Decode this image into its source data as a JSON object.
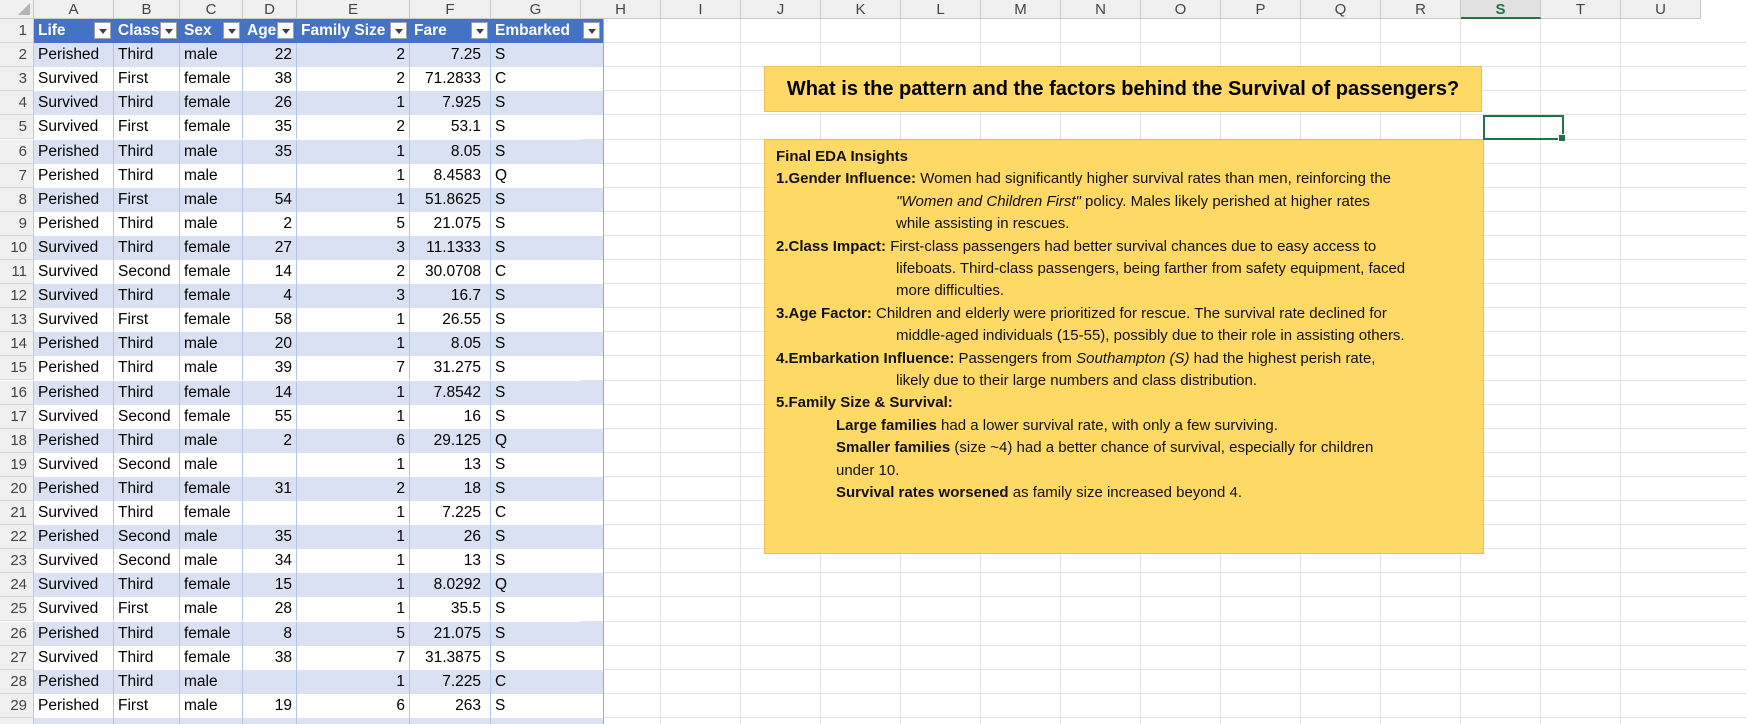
{
  "columns": [
    "A",
    "B",
    "C",
    "D",
    "E",
    "F",
    "G",
    "H",
    "I",
    "J",
    "K",
    "L",
    "M",
    "N",
    "O",
    "P",
    "Q",
    "R",
    "S",
    "T",
    "U"
  ],
  "selected_column": "S",
  "table": {
    "headers": [
      "Life",
      "Class",
      "Sex",
      "Age",
      "Family Size",
      "Fare",
      "Embarked"
    ],
    "rows": [
      [
        "Perished",
        "Third",
        "male",
        "22",
        "2",
        "7.25",
        "S"
      ],
      [
        "Survived",
        "First",
        "female",
        "38",
        "2",
        "71.2833",
        "C"
      ],
      [
        "Survived",
        "Third",
        "female",
        "26",
        "1",
        "7.925",
        "S"
      ],
      [
        "Survived",
        "First",
        "female",
        "35",
        "2",
        "53.1",
        "S"
      ],
      [
        "Perished",
        "Third",
        "male",
        "35",
        "1",
        "8.05",
        "S"
      ],
      [
        "Perished",
        "Third",
        "male",
        "",
        "1",
        "8.4583",
        "Q"
      ],
      [
        "Perished",
        "First",
        "male",
        "54",
        "1",
        "51.8625",
        "S"
      ],
      [
        "Perished",
        "Third",
        "male",
        "2",
        "5",
        "21.075",
        "S"
      ],
      [
        "Survived",
        "Third",
        "female",
        "27",
        "3",
        "11.1333",
        "S"
      ],
      [
        "Survived",
        "Second",
        "female",
        "14",
        "2",
        "30.0708",
        "C"
      ],
      [
        "Survived",
        "Third",
        "female",
        "4",
        "3",
        "16.7",
        "S"
      ],
      [
        "Survived",
        "First",
        "female",
        "58",
        "1",
        "26.55",
        "S"
      ],
      [
        "Perished",
        "Third",
        "male",
        "20",
        "1",
        "8.05",
        "S"
      ],
      [
        "Perished",
        "Third",
        "male",
        "39",
        "7",
        "31.275",
        "S"
      ],
      [
        "Perished",
        "Third",
        "female",
        "14",
        "1",
        "7.8542",
        "S"
      ],
      [
        "Survived",
        "Second",
        "female",
        "55",
        "1",
        "16",
        "S"
      ],
      [
        "Perished",
        "Third",
        "male",
        "2",
        "6",
        "29.125",
        "Q"
      ],
      [
        "Survived",
        "Second",
        "male",
        "",
        "1",
        "13",
        "S"
      ],
      [
        "Perished",
        "Third",
        "female",
        "31",
        "2",
        "18",
        "S"
      ],
      [
        "Survived",
        "Third",
        "female",
        "",
        "1",
        "7.225",
        "C"
      ],
      [
        "Perished",
        "Second",
        "male",
        "35",
        "1",
        "26",
        "S"
      ],
      [
        "Survived",
        "Second",
        "male",
        "34",
        "1",
        "13",
        "S"
      ],
      [
        "Survived",
        "Third",
        "female",
        "15",
        "1",
        "8.0292",
        "Q"
      ],
      [
        "Survived",
        "First",
        "male",
        "28",
        "1",
        "35.5",
        "S"
      ],
      [
        "Perished",
        "Third",
        "female",
        "8",
        "5",
        "21.075",
        "S"
      ],
      [
        "Survived",
        "Third",
        "female",
        "38",
        "7",
        "31.3875",
        "S"
      ],
      [
        "Perished",
        "Third",
        "male",
        "",
        "1",
        "7.225",
        "C"
      ],
      [
        "Perished",
        "First",
        "male",
        "19",
        "6",
        "263",
        "S"
      ]
    ]
  },
  "title_box": {
    "text": "What is the pattern and the factors behind the Survival of passengers?"
  },
  "insights": {
    "heading": "Final EDA Insights",
    "p1_bold": "1.Gender Influence:",
    "p1_a": " Women had significantly higher survival rates than men, reinforcing the",
    "p1_b_italic": "\"Women and Children First\"",
    "p1_b_rest": " policy. Males likely perished at higher rates",
    "p1_c": "while assisting in rescues.",
    "p2_bold": "2.Class Impact:",
    "p2_a": " First-class passengers had better survival chances due to easy access to",
    "p2_b": "lifeboats. Third-class passengers, being farther from safety equipment, faced",
    "p2_c": "more difficulties.",
    "p3_bold": "3.Age Factor:",
    "p3_a": " Children and elderly were prioritized for rescue. The survival rate declined for",
    "p3_b": "middle-aged individuals (15-55), possibly due to their role in assisting others.",
    "p4_bold": "4.Embarkation Influence:",
    "p4_a_pre": " Passengers from ",
    "p4_a_italic": "Southampton (S)",
    "p4_a_post": " had the highest perish rate,",
    "p4_b": "likely due to their large numbers and class distribution.",
    "p5_bold": "5.Family Size & Survival:",
    "p5_l1_bold": "Large families",
    "p5_l1_rest": " had a lower survival rate, with only a few surviving.",
    "p5_l2_bold": "Smaller families",
    "p5_l2_rest": " (size ~4) had a better chance of survival, especially for children",
    "p5_l3": "under 10.",
    "p5_l4_bold": "Survival rates worsened",
    "p5_l4_rest": " as family size increased beyond 4."
  },
  "colors": {
    "table_header": "#4472c4",
    "table_band": "#d9e1f2",
    "note_fill": "#ffd966",
    "selection": "#217346"
  }
}
